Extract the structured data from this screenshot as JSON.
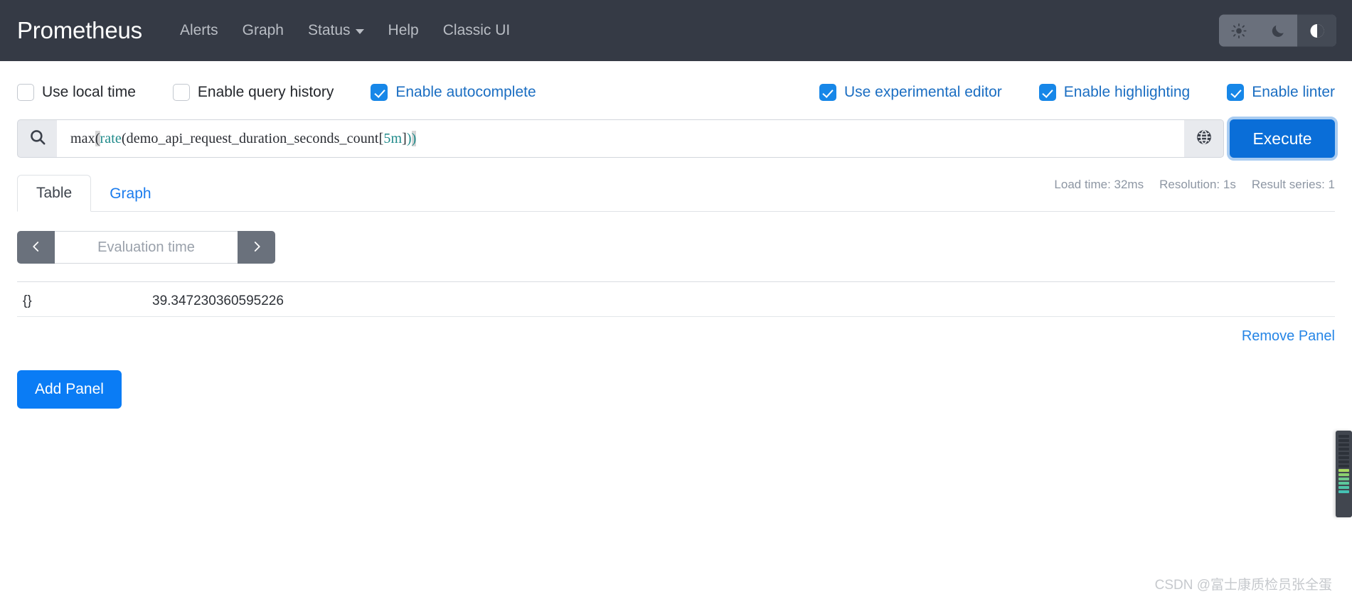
{
  "navbar": {
    "brand": "Prometheus",
    "links": [
      {
        "label": "Alerts",
        "has_caret": false
      },
      {
        "label": "Graph",
        "has_caret": false
      },
      {
        "label": "Status",
        "has_caret": true
      },
      {
        "label": "Help",
        "has_caret": false
      },
      {
        "label": "Classic UI",
        "has_caret": false
      }
    ],
    "theme": {
      "light_icon": "sun-icon",
      "dark_icon": "moon-icon",
      "auto_icon": "half-circle-icon",
      "selected": "auto"
    }
  },
  "options": [
    {
      "label": "Use local time",
      "checked": false
    },
    {
      "label": "Enable query history",
      "checked": false
    },
    {
      "label": "Enable autocomplete",
      "checked": true
    },
    {
      "label": "Use experimental editor",
      "checked": true
    },
    {
      "label": "Enable highlighting",
      "checked": true
    },
    {
      "label": "Enable linter",
      "checked": true
    }
  ],
  "query": {
    "search_icon": "search-icon",
    "globe_icon": "globe-icon",
    "expression": "max(rate(demo_api_request_duration_seconds_count[5m]))",
    "tokens": {
      "fn_outer": "max",
      "paren_open_outer": "(",
      "fn_inner": "rate",
      "paren_open_inner": "(",
      "metric": "demo_api_request_duration_seconds_count",
      "bracket_open": "[",
      "duration": "5m",
      "bracket_close": "]",
      "paren_close_inner": ")",
      "paren_close_outer": ")"
    },
    "execute_label": "Execute"
  },
  "panel": {
    "tabs": [
      {
        "label": "Table",
        "active": true
      },
      {
        "label": "Graph",
        "active": false
      }
    ],
    "meta": {
      "load_time": "Load time: 32ms",
      "resolution": "Resolution: 1s",
      "result_series": "Result series: 1"
    },
    "evaluation_time": {
      "prev_icon": "chevron-left-icon",
      "next_icon": "chevron-right-icon",
      "placeholder": "Evaluation time",
      "value": ""
    },
    "result": {
      "rows": [
        {
          "labels": "{}",
          "value": "39.347230360595226"
        }
      ]
    },
    "remove_panel_label": "Remove Panel"
  },
  "add_panel_label": "Add Panel",
  "watermark": "CSDN @富士康质检员张全蛋",
  "colors": {
    "navbar_bg": "#353a45",
    "accent_blue": "#0a7cf5",
    "execute_blue": "#0a6ed8",
    "link_blue": "#1b7ced",
    "checkbox_blue": "#1787e8",
    "fn_teal": "#1f8a8a",
    "muted_text": "#8d96a3"
  }
}
